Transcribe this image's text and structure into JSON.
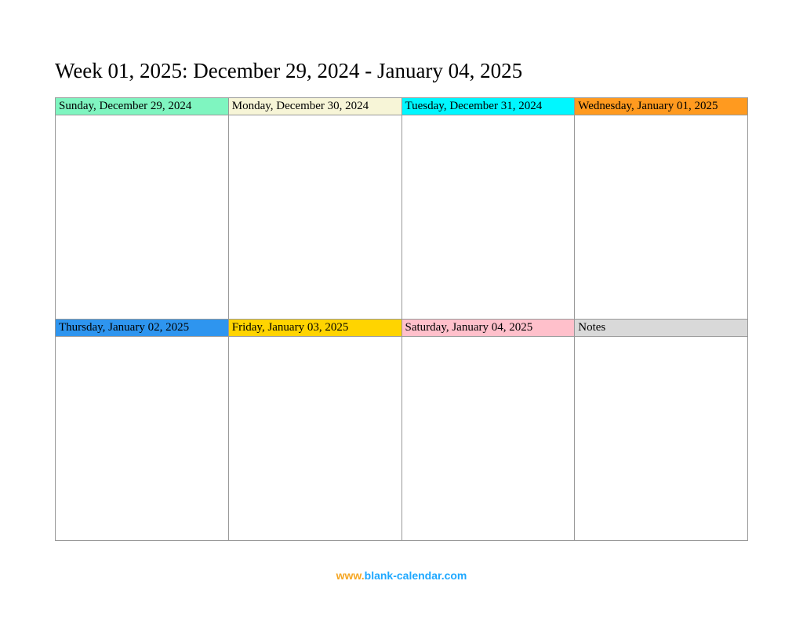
{
  "title": "Week 01, 2025: December 29, 2024 - January 04, 2025",
  "cells": [
    {
      "label": "Sunday, December 29, 2024",
      "color": "#7ff5c0"
    },
    {
      "label": "Monday, December 30, 2024",
      "color": "#f7f5d7"
    },
    {
      "label": "Tuesday, December 31, 2024",
      "color": "#00f7ff"
    },
    {
      "label": "Wednesday, January 01, 2025",
      "color": "#ff9a1f"
    },
    {
      "label": "Thursday, January 02, 2025",
      "color": "#2e95ef"
    },
    {
      "label": "Friday, January 03, 2025",
      "color": "#ffd400"
    },
    {
      "label": "Saturday, January 04, 2025",
      "color": "#ffc0cb"
    },
    {
      "label": "Notes",
      "color": "#d9d9d9"
    }
  ],
  "footer": {
    "part1": "www.",
    "part2": "blank-calendar.com"
  }
}
